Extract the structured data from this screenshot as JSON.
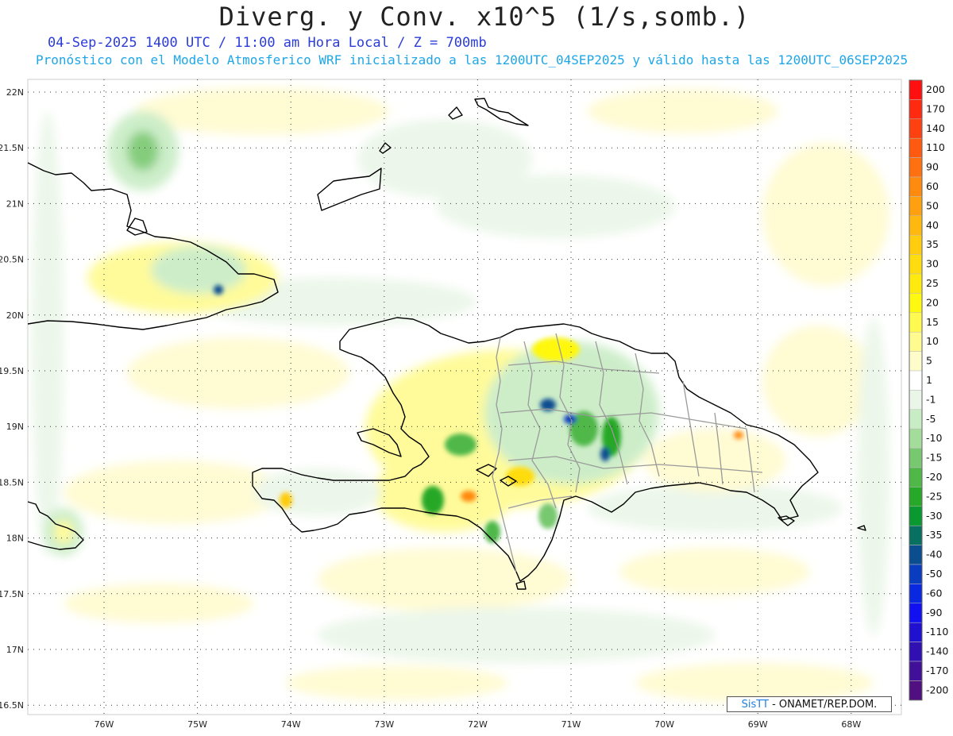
{
  "header": {
    "title": "Diverg. y Conv. x10^5 (1/s,somb.)",
    "subtitle_date": "04-Sep-2025 1400 UTC / 11:00 am Hora Local / Z = 700mb",
    "subtitle_model": "Pronóstico con el Modelo Atmosferico WRF inicializado a las 1200UTC_04SEP2025 y válido hasta las  1200UTC_06SEP2025"
  },
  "map": {
    "lat_labels": [
      "22N",
      "21.5N",
      "21N",
      "20.5N",
      "20N",
      "19.5N",
      "19N",
      "18.5N",
      "18N",
      "17.5N",
      "17N",
      "16.5N"
    ],
    "lon_labels": [
      "76W",
      "75W",
      "74W",
      "73W",
      "72W",
      "71W",
      "70W",
      "69W",
      "68W"
    ]
  },
  "legend": {
    "levels": [
      {
        "label": "200",
        "color": "#ff1010"
      },
      {
        "label": "170",
        "color": "#ff2a10"
      },
      {
        "label": "140",
        "color": "#ff4010"
      },
      {
        "label": "110",
        "color": "#ff5a10"
      },
      {
        "label": "90",
        "color": "#ff7010"
      },
      {
        "label": "60",
        "color": "#ff8a10"
      },
      {
        "label": "50",
        "color": "#ffa010"
      },
      {
        "label": "40",
        "color": "#ffb810"
      },
      {
        "label": "35",
        "color": "#ffcc10"
      },
      {
        "label": "30",
        "color": "#ffdc10"
      },
      {
        "label": "25",
        "color": "#ffea10"
      },
      {
        "label": "20",
        "color": "#fff810"
      },
      {
        "label": "15",
        "color": "#fffa50"
      },
      {
        "label": "10",
        "color": "#fffb90"
      },
      {
        "label": "5",
        "color": "#fffccc"
      },
      {
        "label": "1",
        "color": "#ffffff"
      },
      {
        "label": "-1",
        "color": "#eaf6e8"
      },
      {
        "label": "-5",
        "color": "#c8ecc4"
      },
      {
        "label": "-10",
        "color": "#a4dc9c"
      },
      {
        "label": "-15",
        "color": "#78c870"
      },
      {
        "label": "-20",
        "color": "#50b848"
      },
      {
        "label": "-25",
        "color": "#28a828"
      },
      {
        "label": "-30",
        "color": "#0a9830"
      },
      {
        "label": "-35",
        "color": "#087060"
      },
      {
        "label": "-40",
        "color": "#0a4e90"
      },
      {
        "label": "-50",
        "color": "#0a3cc0"
      },
      {
        "label": "-60",
        "color": "#0a28e0"
      },
      {
        "label": "-90",
        "color": "#1010f0"
      },
      {
        "label": "-110",
        "color": "#2010d0"
      },
      {
        "label": "-140",
        "color": "#3010b0"
      },
      {
        "label": "-170",
        "color": "#401098"
      },
      {
        "label": "-200",
        "color": "#501080"
      }
    ]
  },
  "credit": {
    "logo": "SisTT",
    "text": " - ONAMET/REP.DOM."
  }
}
